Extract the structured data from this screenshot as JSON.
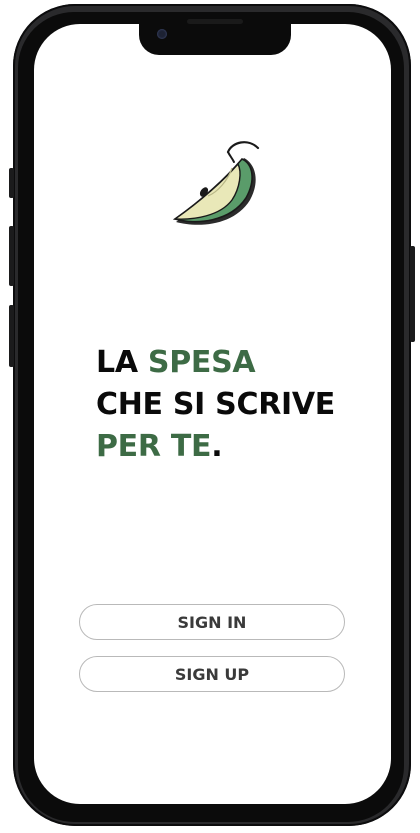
{
  "app": {
    "logo_icon": "apple-slice-icon",
    "accent_color": "#3d6b45"
  },
  "headline": {
    "line1_black": "LA ",
    "line1_green": "SPESA",
    "line2": "CHE SI SCRIVE",
    "line3_green": "PER TE",
    "line3_dot": "."
  },
  "actions": {
    "sign_in_label": "SIGN IN",
    "sign_up_label": "SIGN UP"
  }
}
